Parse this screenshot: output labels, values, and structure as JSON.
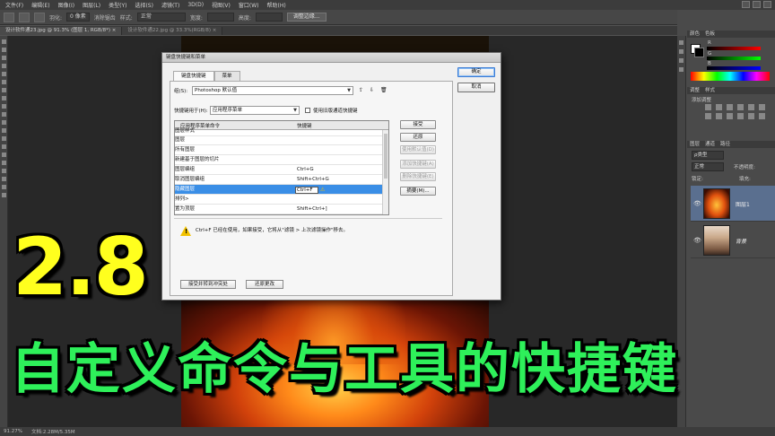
{
  "menu": [
    "文件(F)",
    "编辑(E)",
    "图像(I)",
    "图层(L)",
    "类型(Y)",
    "选择(S)",
    "滤镜(T)",
    "3D(D)",
    "视图(V)",
    "窗口(W)",
    "帮助(H)"
  ],
  "options_bar": {
    "feather_label": "羽化:",
    "feather_value": "0 像素",
    "antialias_label": "消除锯齿",
    "style_label": "样式:",
    "style_value": "正常",
    "width_label": "宽度:",
    "height_label": "高度:",
    "refine_button": "调整边缘..."
  },
  "doc_tabs": [
    {
      "label": "设计软件通23.jpg @ 91.3% (图层 1, RGB/8*) ×",
      "active": true
    },
    {
      "label": "设计软件通22.jpg @ 33.3%(RGB/8) ×",
      "active": false
    }
  ],
  "status": {
    "zoom": "91.27%",
    "doc": "文档:2.28M/5.35M"
  },
  "right_panels": {
    "color_tabs": [
      "颜色",
      "色板"
    ],
    "color_values": [
      "R",
      "G",
      "B"
    ],
    "adjust_tabs": [
      "调整",
      "样式"
    ],
    "adjust_label": "添加调整",
    "layers_tabs": [
      "图层",
      "通道",
      "路径"
    ],
    "layer_kind": "ρ类型",
    "blend_mode": "正常",
    "opacity_label": "不透明度:",
    "lock_label": "锁定:",
    "fill_label": "填充:",
    "layers": [
      {
        "name": "图层1",
        "selected": true
      },
      {
        "name": "背景",
        "selected": false
      }
    ]
  },
  "dialog": {
    "title": "键盘快捷键和菜单",
    "tabs": [
      "键盘快捷键",
      "菜单"
    ],
    "set_label": "组(S):",
    "set_value": "Photoshop 默认值",
    "shortcuts_for_label": "快捷键用于(H):",
    "shortcuts_for_value": "应用程序菜单",
    "legacy_checkbox": "使用旧版通道快捷键",
    "col_command": "应用程序菜单命令",
    "col_shortcut": "快捷键",
    "rows": [
      {
        "cmd": "   图层样式",
        "key": ""
      },
      {
        "cmd": "      图层",
        "key": ""
      },
      {
        "cmd": "      所有图层",
        "key": ""
      },
      {
        "cmd": "   新建基于图层的切片",
        "key": ""
      },
      {
        "cmd": "   图层编组",
        "key": "Ctrl+G"
      },
      {
        "cmd": "   取消图层编组",
        "key": "Shift+Ctrl+G"
      },
      {
        "cmd": "   隐藏图层",
        "key": "Ctrl+F",
        "selected": true
      },
      {
        "cmd": "   排列>",
        "key": ""
      },
      {
        "cmd": "      置为顶层",
        "key": "Shift+Ctrl+]"
      }
    ],
    "side_buttons": [
      "接受",
      "还原",
      "使用默认值(D)",
      "添加快捷键(A)",
      "删除快捷键(E)",
      "摘要(M)..."
    ],
    "main_buttons": [
      "确定",
      "取消"
    ],
    "message": "Ctrl+F 已经在使用，如果接受，它将从\"滤镜 > 上次滤镜操作\"移去。",
    "bottom_buttons": [
      "接受并转到冲突处",
      "还原更改"
    ]
  },
  "overlay": {
    "number": "2.8",
    "caption": "自定义命令与工具的快捷键"
  }
}
